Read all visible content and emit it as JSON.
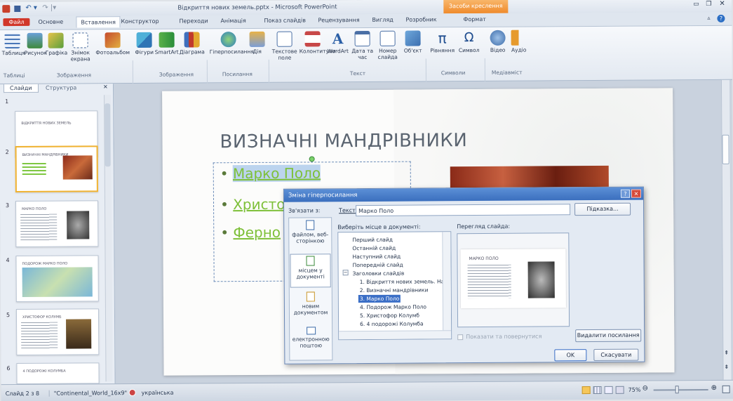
{
  "window": {
    "title": "Відкриття нових земель.pptx - Microsoft PowerPoint",
    "context_tab": "Засоби креслення"
  },
  "tabs": [
    "Файл",
    "Основне",
    "Вставлення",
    "Конструктор",
    "Переходи",
    "Анімація",
    "Показ слайдів",
    "Рецензування",
    "Вигляд",
    "Розробник",
    "Формат"
  ],
  "ribbon": {
    "buttons": {
      "table": "Таблиця",
      "picture": "Рисунок",
      "clipart": "Графіка",
      "screenshot": "Знімок екрана",
      "album": "Фотоальбом",
      "shapes": "Фігури",
      "smartart": "SmartArt",
      "chart": "Діаграма",
      "hyperlink": "Гіперпосилання",
      "action": "Дія",
      "textbox": "Текстове поле",
      "header": "Колонтитули",
      "wordart": "WordArt",
      "datetime": "Дата та час",
      "slidenum": "Номер слайда",
      "object": "Об'єкт",
      "equation": "Рівняння",
      "symbol": "Символ",
      "video": "Відео",
      "audio": "Аудіо"
    },
    "groups": {
      "tables": "Таблиці",
      "images": "Зображення",
      "illustrations": "Зображення",
      "links": "Посилання",
      "text": "Текст",
      "symbols": "Символи",
      "media": "Медіавміст"
    }
  },
  "pane": {
    "tab_slides": "Слайди",
    "tab_outline": "Структура",
    "thumbs": [
      {
        "num": "1",
        "title": "ВІДКРИТТЯ НОВИХ ЗЕМЕЛЬ"
      },
      {
        "num": "2",
        "title": "ВИЗНАЧНІ МАНДРІВНИКИ"
      },
      {
        "num": "3",
        "title": "МАРКО ПОЛО"
      },
      {
        "num": "4",
        "title": "ПОДОРОЖ МАРКО ПОЛО"
      },
      {
        "num": "5",
        "title": "ХРИСТОФОР КОЛУМБ"
      },
      {
        "num": "6",
        "title": "4 ПОДОРОЖІ КОЛУМБА"
      }
    ]
  },
  "slide": {
    "title": "ВИЗНАЧНІ МАНДРІВНИКИ",
    "bullets": [
      "Марко Поло",
      "Христо",
      "Ферно"
    ]
  },
  "dialog": {
    "title": "Зміна гіперпосилання",
    "link_to": "Зв'язати з:",
    "text_label": "Текст:",
    "text_value": "Марко Поло",
    "hint_button": "Підказка...",
    "place_label": "Виберіть місце в документі:",
    "preview_label": "Перегляд слайда:",
    "nav": [
      "файлом, веб-сторінкою",
      "місцем у документі",
      "новим документом",
      "електронною поштою"
    ],
    "tree": [
      "Перший слайд",
      "Останній слайд",
      "Наступний слайд",
      "Попередній слайд",
      "Заголовки слайдів",
      "1. Відкриття нових земель. На",
      "2. Визначні мандрівники",
      "3. Марко Поло",
      "4. Подорож Марко Поло",
      "5. Христофор Колумб",
      "6. 4 подорожі Колумба"
    ],
    "preview_title": "МАРКО ПОЛО",
    "show_return": "Показати та повернутися",
    "remove_link": "Видалити посилання",
    "ok": "OK",
    "cancel": "Скасувати"
  },
  "status": {
    "slide": "Слайд 2 з 8",
    "theme": "\"Continental_World_16x9\"",
    "lang": "українська",
    "zoom": "75%"
  }
}
